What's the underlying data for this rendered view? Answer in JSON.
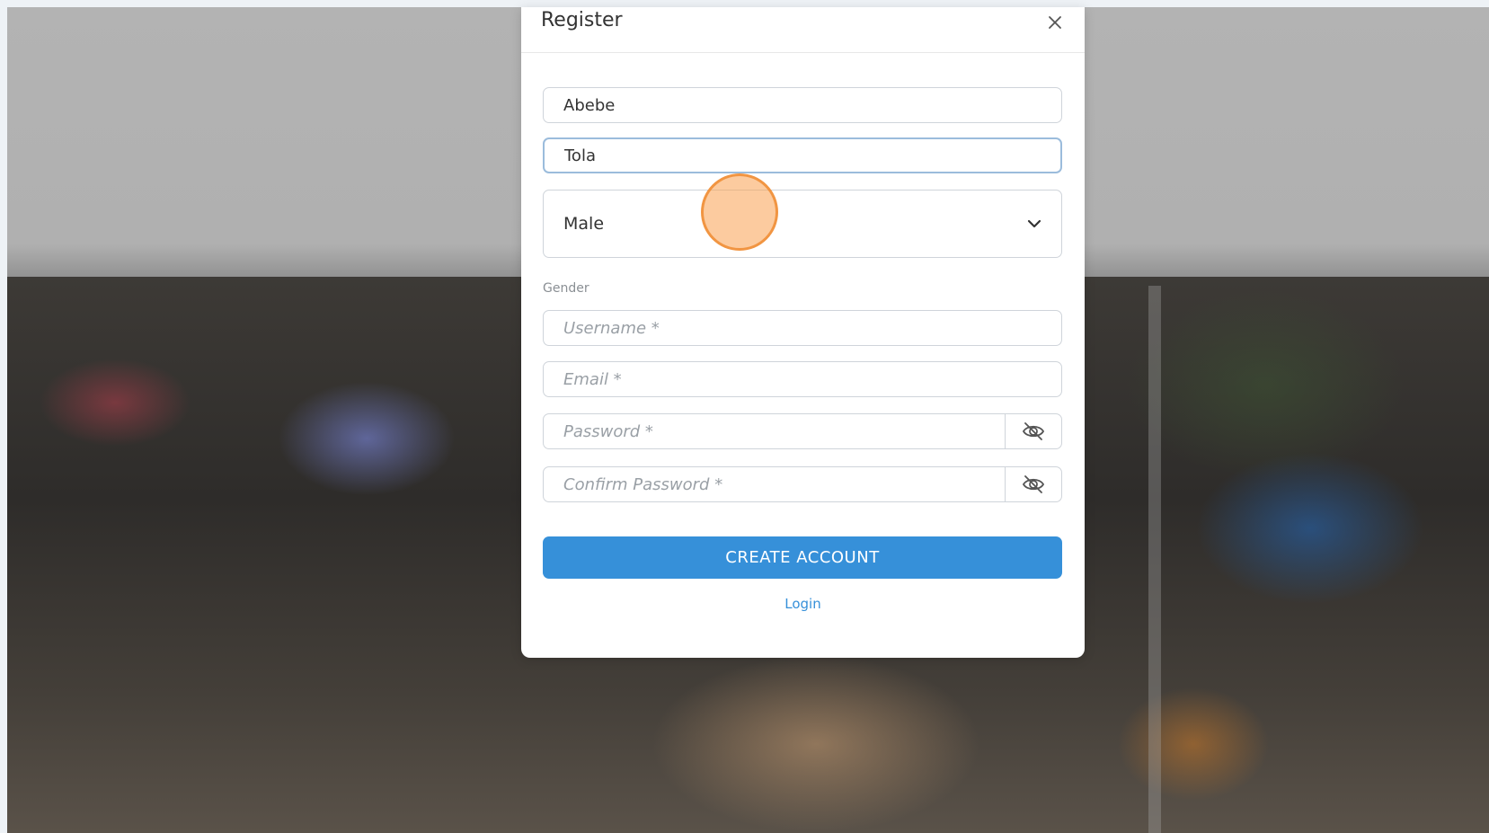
{
  "modal": {
    "title": "Register",
    "close_icon": "close-icon"
  },
  "form": {
    "first_name": {
      "value": "Abebe"
    },
    "last_name": {
      "value": "Tola"
    },
    "gender": {
      "value": "Male",
      "helper": "Gender",
      "icon": "chevron-down-icon"
    },
    "username": {
      "value": "",
      "placeholder": "Username *"
    },
    "email": {
      "value": "",
      "placeholder": "Email *"
    },
    "password": {
      "value": "",
      "placeholder": "Password *",
      "icon": "eye-off-icon"
    },
    "confirm_password": {
      "value": "",
      "placeholder": "Confirm Password *",
      "icon": "eye-off-icon"
    },
    "create_account_label": "CREATE ACCOUNT",
    "login_link": "Login"
  },
  "colors": {
    "primary": "#3690d9",
    "click_indicator": "#f5a050"
  }
}
